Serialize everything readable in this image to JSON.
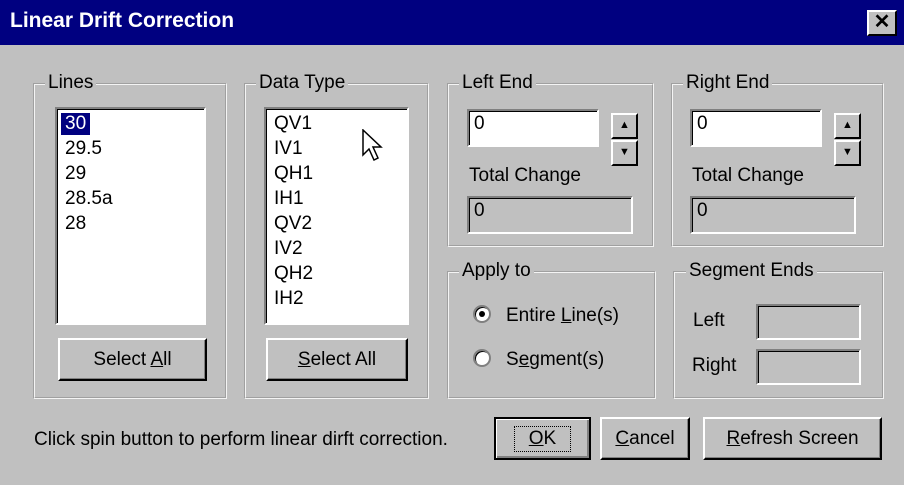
{
  "window": {
    "title": "Linear Drift Correction",
    "close_label": "✕"
  },
  "lines": {
    "label": "Lines",
    "items": [
      "30",
      "29.5",
      "29",
      "28.5a",
      "28"
    ],
    "selected": "30",
    "select_all": {
      "pre": "Select ",
      "accel": "A",
      "post": "ll"
    }
  },
  "data_type": {
    "label": "Data Type",
    "items": [
      "QV1",
      "IV1",
      "QH1",
      "IH1",
      "QV2",
      "IV2",
      "QH2",
      "IH2"
    ],
    "select_all": {
      "pre": "",
      "accel": "S",
      "post": "elect All"
    }
  },
  "left_end": {
    "label": "Left End",
    "value": "0",
    "total_change_label": "Total Change",
    "total_change": "0"
  },
  "right_end": {
    "label": "Right End",
    "value": "0",
    "total_change_label": "Total Change",
    "total_change": "0"
  },
  "apply_to": {
    "label": "Apply to",
    "entire": {
      "pre": "Entire ",
      "accel": "L",
      "post": "ine(s)"
    },
    "segment": {
      "pre": "S",
      "accel": "e",
      "post": "gment(s)"
    },
    "selected": "entire"
  },
  "segment_ends": {
    "label": "Segment Ends",
    "left_label": "Left",
    "right_label": "Right",
    "left": "",
    "right": ""
  },
  "footer": {
    "hint": "Click spin button to perform linear dirft correction.",
    "ok": {
      "pre": "",
      "accel": "O",
      "post": "K"
    },
    "cancel": {
      "pre": "",
      "accel": "C",
      "post": "ancel"
    },
    "refresh": {
      "pre": "",
      "accel": "R",
      "post": "efresh Screen"
    }
  },
  "icons": {
    "spin_up": "up-arrow-icon",
    "spin_down": "down-arrow-icon",
    "cursor": "mouse-pointer-icon"
  },
  "colors": {
    "title_bar": "#000080",
    "face": "#c0c0c0",
    "selection": "#000080"
  }
}
